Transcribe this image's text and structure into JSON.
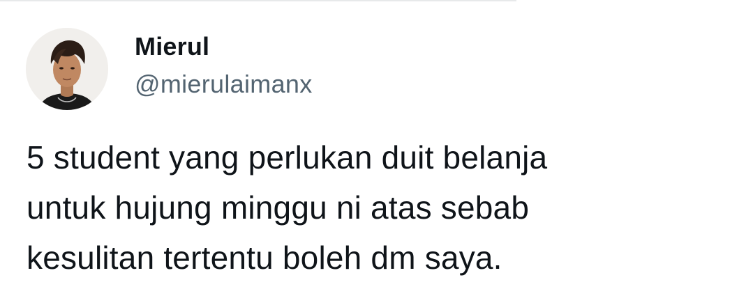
{
  "author": {
    "display_name": "Mierul",
    "handle": "@mierulaimanx",
    "avatar_icon": "profile-photo"
  },
  "tweet": {
    "lines": [
      "5 student yang perlukan duit belanja",
      "untuk hujung minggu ni atas sebab",
      "kesulitan tertentu boleh dm saya."
    ]
  },
  "colors": {
    "name": "#0f1419",
    "handle": "#536471",
    "text": "#0f1419",
    "background": "#ffffff"
  }
}
